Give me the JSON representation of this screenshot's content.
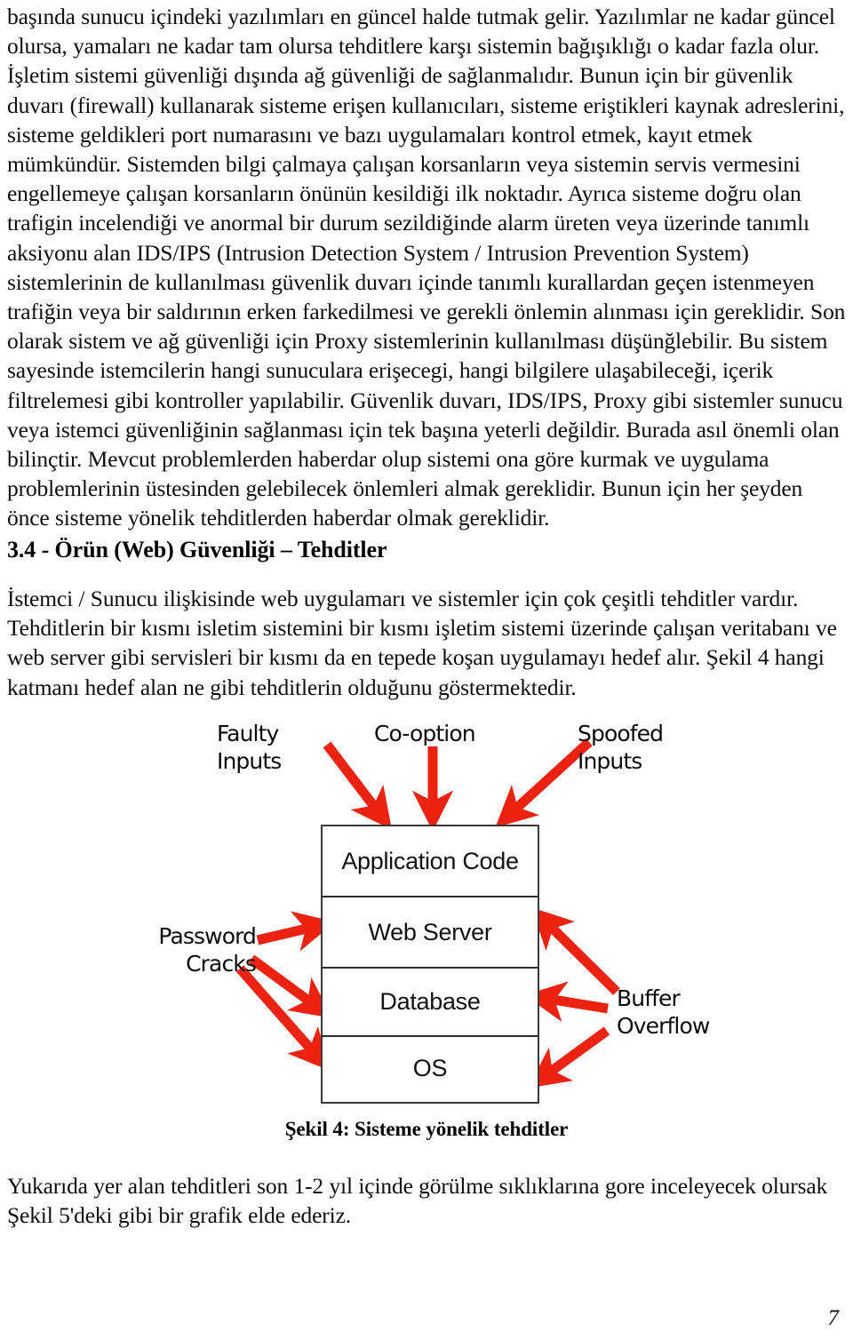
{
  "document": {
    "page_number": "7",
    "paragraphs": {
      "p1": "başında sunucu içindeki yazılımları en güncel halde tutmak gelir. Yazılımlar ne kadar güncel olursa, yamaları ne kadar tam olursa tehditlere karşı sistemin bağışıklığı o kadar fazla olur. İşletim sistemi güvenliği dışında ağ güvenliği de sağlanmalıdır. Bunun için bir güvenlik duvarı (firewall) kullanarak sisteme erişen kullanıcıları, sisteme eriştikleri kaynak adreslerini, sisteme geldikleri port numarasını ve bazı uygulamaları kontrol etmek, kayıt etmek mümkündür. Sistemden bilgi çalmaya çalışan korsanların veya sistemin servis vermesini engellemeye çalışan korsanların önünün kesildiği ilk noktadır. Ayrıca sisteme doğru olan trafigin incelendiği ve anormal bir durum sezildiğinde alarm üreten veya üzerinde tanımlı aksiyonu alan IDS/IPS (Intrusion Detection System / Intrusion Prevention System) sistemlerinin de kullanılması güvenlik duvarı içinde tanımlı kurallardan geçen istenmeyen trafiğin veya bir saldırının erken farkedilmesi ve gerekli önlemin alınması için gereklidir. Son olarak sistem ve ağ güvenliği için Proxy sistemlerinin kullanılması düşünğlebilir. Bu sistem sayesinde istemcilerin hangi sunuculara erişecegi, hangi bilgilere ulaşabileceği, içerik filtrelemesi gibi kontroller yapılabilir. Güvenlik duvarı, IDS/IPS, Proxy gibi sistemler sunucu veya istemci güvenliğinin sağlanması için tek başına yeterli değildir. Burada asıl önemli olan bilinçtir. Mevcut problemlerden haberdar olup sistemi ona göre kurmak ve uygulama problemlerinin üstesinden gelebilecek önlemleri almak gereklidir. Bunun için her şeyden önce sisteme yönelik tehditlerden haberdar olmak gereklidir.",
      "p2": "İstemci / Sunucu ilişkisinde web uygulamarı ve sistemler için çok çeşitli tehditler vardır. Tehditlerin bir kısmı isletim sistemini bir kısmı işletim sistemi üzerinde çalışan veritabanı ve web server gibi servisleri bir kısmı da en tepede koşan uygulamayı hedef alır. Şekil 4 hangi katmanı hedef alan ne gibi tehditlerin olduğunu göstermektedir.",
      "p3": "Yukarıda yer alan tehditleri son 1-2 yıl içinde görülme sıklıklarına gore inceleyecek olursak Şekil 5'deki gibi bir grafik elde ederiz."
    },
    "section_heading": "3.4 - Örün (Web) Güvenliği – Tehditler",
    "figure": {
      "caption": "Şekil 4: Sisteme yönelik tehditler",
      "arrow_color": "#EE2211",
      "box_border_color": "#3A3A3A",
      "layers": [
        {
          "id": "application-code",
          "label": "Application Code"
        },
        {
          "id": "web-server",
          "label": "Web Server"
        },
        {
          "id": "database",
          "label": "Database"
        },
        {
          "id": "os",
          "label": "OS"
        }
      ],
      "threat_labels": [
        {
          "id": "faulty-inputs",
          "label": "Faulty\nInputs",
          "targets": [
            "application-code"
          ],
          "side": "top-left"
        },
        {
          "id": "co-option",
          "label": "Co-option",
          "targets": [
            "application-code"
          ],
          "side": "top-center"
        },
        {
          "id": "spoofed-inputs",
          "label": "Spoofed\nInputs",
          "targets": [
            "application-code"
          ],
          "side": "top-right"
        },
        {
          "id": "password-cracks",
          "label": "Password\nCracks",
          "targets": [
            "web-server",
            "database",
            "os"
          ],
          "side": "left"
        },
        {
          "id": "buffer-overflow",
          "label": "Buffer\nOverflow",
          "targets": [
            "web-server",
            "database",
            "os"
          ],
          "side": "right"
        }
      ]
    }
  }
}
